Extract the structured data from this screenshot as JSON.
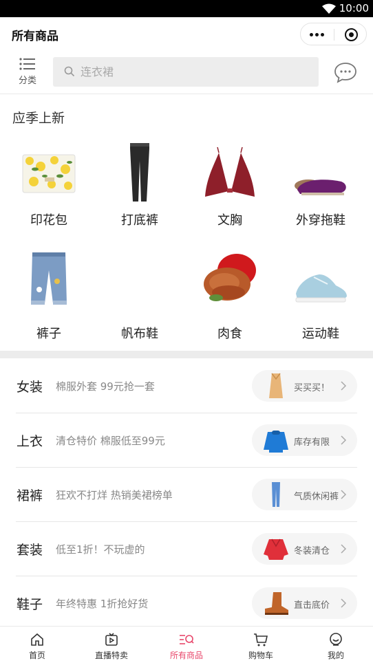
{
  "status_bar": {
    "time": "10:00"
  },
  "header": {
    "title": "所有商品"
  },
  "search": {
    "category_label": "分类",
    "placeholder": "连衣裙"
  },
  "section": {
    "title": "应季上新"
  },
  "grid": [
    {
      "label": "印花包",
      "icon": "lemon-print-bag"
    },
    {
      "label": "打底裤",
      "icon": "black-leggings"
    },
    {
      "label": "文胸",
      "icon": "red-bra"
    },
    {
      "label": "外穿拖鞋",
      "icon": "purple-fur-slipper"
    },
    {
      "label": "裤子",
      "icon": "kids-jeans"
    },
    {
      "label": "帆布鞋",
      "icon": "canvas-shoe"
    },
    {
      "label": "肉食",
      "icon": "braised-meat"
    },
    {
      "label": "运动鞋",
      "icon": "blue-sneaker"
    }
  ],
  "categories": [
    {
      "name": "女装",
      "desc": "棉服外套 99元抢一套",
      "tag": "买买买！",
      "icon": "camel-coat"
    },
    {
      "name": "上衣",
      "desc": "清仓特价 棉服低至99元",
      "tag": "库存有限",
      "icon": "blue-jacket"
    },
    {
      "name": "裙裤",
      "desc": "狂欢不打烊 热销美裙榜单",
      "tag": "气质休闲裤",
      "icon": "jeans"
    },
    {
      "name": "套装",
      "desc": "低至1折！不玩虚的",
      "tag": "冬装清仓",
      "icon": "red-blouse"
    },
    {
      "name": "鞋子",
      "desc": "年终特惠 1折抢好货",
      "tag": "直击底价",
      "icon": "brown-boot"
    }
  ],
  "tabs": [
    {
      "label": "首页",
      "icon": "home-icon"
    },
    {
      "label": "直播特卖",
      "icon": "live-icon"
    },
    {
      "label": "所有商品",
      "icon": "all-products-icon",
      "active": true
    },
    {
      "label": "购物车",
      "icon": "cart-icon"
    },
    {
      "label": "我的",
      "icon": "profile-icon"
    }
  ],
  "colors": {
    "accent": "#e8466a",
    "text": "#222222",
    "muted": "#888888"
  }
}
